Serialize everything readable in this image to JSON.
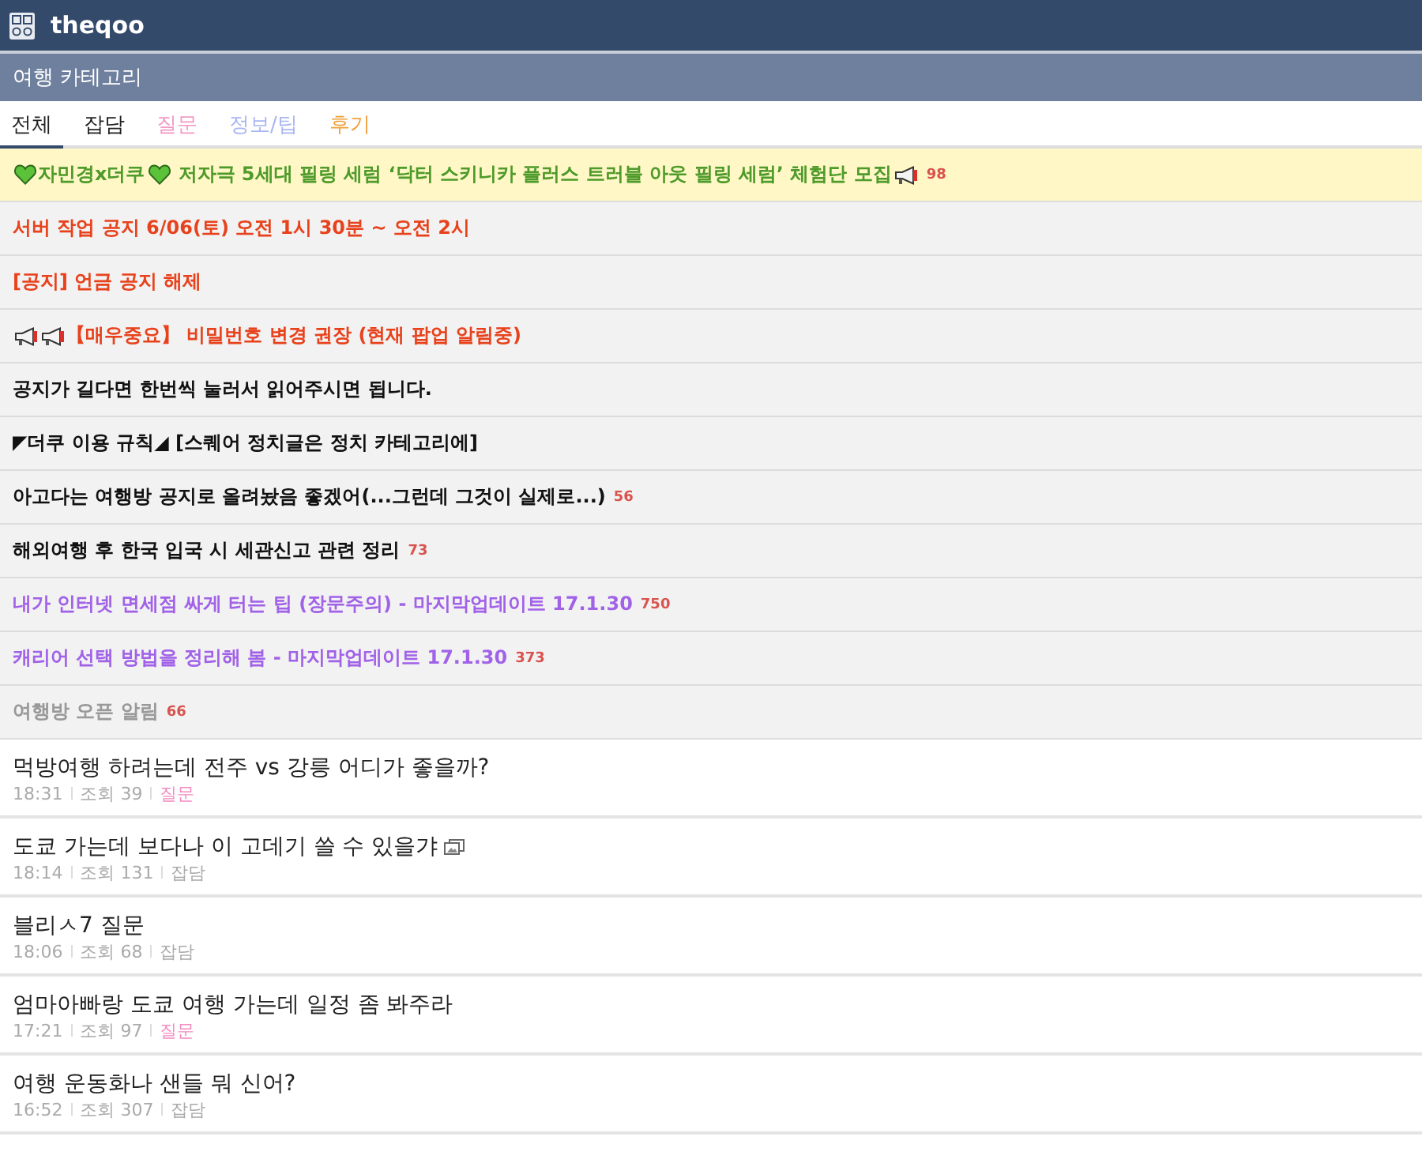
{
  "header": {
    "site_name": "theqoo"
  },
  "category_bar": {
    "title": "여행 카테고리"
  },
  "tabs": [
    {
      "label": "전체",
      "selected": true,
      "color": "#222222"
    },
    {
      "label": "잡담",
      "selected": false,
      "color": "#222222"
    },
    {
      "label": "질문",
      "selected": false,
      "color": "#f29ac6"
    },
    {
      "label": "정보/팁",
      "selected": false,
      "color": "#a9b6f0"
    },
    {
      "label": "후기",
      "selected": false,
      "color": "#f0a03a"
    }
  ],
  "notices": [
    {
      "kind": "sponsored",
      "color": "#4e9a2a",
      "parts": [
        {
          "kind": "heart"
        },
        {
          "kind": "text",
          "text": "자민경x더쿠"
        },
        {
          "kind": "heart"
        },
        {
          "kind": "text",
          "text": "저자극 5세대 필링 세럼 ‘닥터 스키니카 플러스 트러블 아웃 필링 세럼’ 체험단 모집"
        },
        {
          "kind": "megaphone"
        }
      ],
      "comments": "98"
    },
    {
      "kind": "notice",
      "color": "#e8421c",
      "parts": [
        {
          "kind": "text",
          "text": "서버 작업 공지 6/06(토) 오전 1시 30분 ~ 오전 2시"
        }
      ]
    },
    {
      "kind": "notice",
      "color": "#e8421c",
      "parts": [
        {
          "kind": "text",
          "text": "[공지] 언금 공지 해제"
        }
      ]
    },
    {
      "kind": "notice",
      "color": "#e8421c",
      "parts": [
        {
          "kind": "megaphone"
        },
        {
          "kind": "megaphone"
        },
        {
          "kind": "text",
          "text": "【매우중요】 비밀번호 변경 권장 (현재 팝업 알림중)"
        }
      ]
    },
    {
      "kind": "notice",
      "color": "#111111",
      "parts": [
        {
          "kind": "text",
          "text": "공지가 길다면 한번씩 눌러서 읽어주시면 됩니다."
        }
      ]
    },
    {
      "kind": "notice",
      "color": "#111111",
      "parts": [
        {
          "kind": "text",
          "text": "◤더쿠 이용 규칙◢ [스퀘어 정치글은 정치 카테고리에]"
        }
      ]
    },
    {
      "kind": "notice",
      "color": "#111111",
      "parts": [
        {
          "kind": "text",
          "text": "아고다는 여행방 공지로 올려놨음 좋겠어(...그런데 그것이 실제로...)"
        }
      ],
      "comments": "56"
    },
    {
      "kind": "notice",
      "color": "#111111",
      "parts": [
        {
          "kind": "text",
          "text": "해외여행 후 한국 입국 시 세관신고 관련 정리"
        }
      ],
      "comments": "73"
    },
    {
      "kind": "notice",
      "color": "#a162e8",
      "parts": [
        {
          "kind": "text",
          "text": "내가 인터넷 면세점 싸게 터는 팁 (장문주의) - 마지막업데이트 17.1.30"
        }
      ],
      "comments": "750"
    },
    {
      "kind": "notice",
      "color": "#a162e8",
      "parts": [
        {
          "kind": "text",
          "text": "캐리어 선택 방법을 정리해 봄 - 마지막업데이트 17.1.30"
        }
      ],
      "comments": "373"
    },
    {
      "kind": "notice",
      "color": "#999999",
      "parts": [
        {
          "kind": "text",
          "text": "여행방 오픈 알림"
        }
      ],
      "comments": "66"
    }
  ],
  "posts": [
    {
      "title": "먹방여행 하려는데 전주 vs 강릉 어디가 좋을까?",
      "has_image": false,
      "time": "18:31",
      "views": "조회 39",
      "category": {
        "label": "질문",
        "color": "#f28cc0"
      }
    },
    {
      "title": "도쿄 가는데 보다나 이 고데기 쓸 수 있을갸",
      "has_image": true,
      "time": "18:14",
      "views": "조회 131",
      "category": {
        "label": "잡담",
        "color": "#aaaaaa"
      }
    },
    {
      "title": "블리ㅅ7 질문",
      "has_image": false,
      "time": "18:06",
      "views": "조회 68",
      "category": {
        "label": "잡담",
        "color": "#aaaaaa"
      }
    },
    {
      "title": "엄마아빠랑 도쿄 여행 가는데 일정 좀 봐주라",
      "has_image": false,
      "time": "17:21",
      "views": "조회 97",
      "category": {
        "label": "질문",
        "color": "#f28cc0"
      }
    },
    {
      "title": "여행 운동화나 샌들 뭐 신어?",
      "has_image": false,
      "time": "16:52",
      "views": "조회 307",
      "category": {
        "label": "잡담",
        "color": "#aaaaaa"
      }
    }
  ]
}
